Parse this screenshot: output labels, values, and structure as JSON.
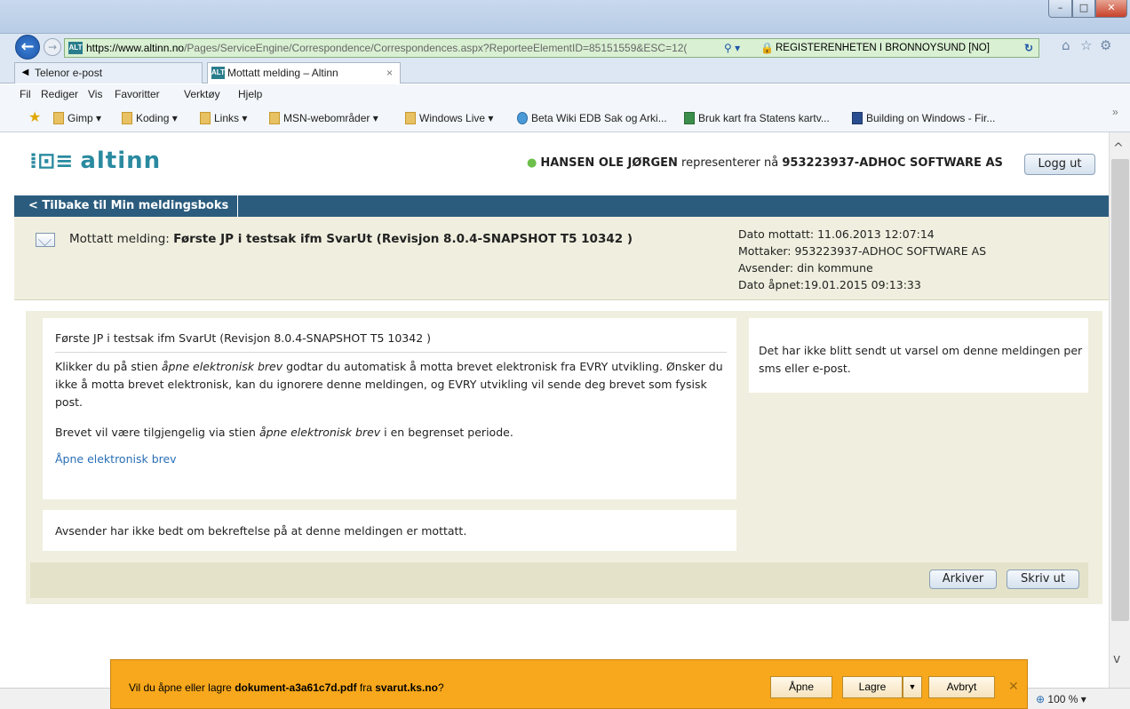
{
  "window": {
    "min": "–",
    "max": "□",
    "close": "✕"
  },
  "browser": {
    "url_host": "https://www.altinn.no",
    "url_rest": "/Pages/ServiceEngine/Correspondence/Correspondences.aspx?ReporteeElementID=85151559&ESC=12(",
    "search_dropdown": "⚲ ▾",
    "certificate": "REGISTERENHETEN I BRONNOYSUND [NO]",
    "tabs": [
      {
        "label": "Telenor e-post"
      },
      {
        "label": "Mottatt melding – Altinn"
      }
    ],
    "menu": [
      "Fil",
      "Rediger",
      "Vis",
      "Favoritter",
      "Verktøy",
      "Hjelp"
    ],
    "favorites": [
      "Gimp ▾",
      "Koding ▾",
      "Links ▾",
      "MSN-webområder ▾",
      "Windows Live ▾",
      "Beta Wiki EDB Sak og Arki...",
      "Bruk kart fra Statens kartv...",
      "Building on Windows - Fir..."
    ],
    "zoom": "100 %"
  },
  "header": {
    "logo_text": "altinn",
    "user_name": "HANSEN OLE JØRGEN",
    "represents_text": "representerer nå",
    "org": "953223937-ADHOC SOFTWARE AS",
    "logout": "Logg ut"
  },
  "nav": {
    "back_link": "< Tilbake til Min meldingsboks"
  },
  "message": {
    "subject_prefix": "Mottatt melding:",
    "subject": "Første JP i testsak ifm SvarUt (Revisjon 8.0.4-SNAPSHOT T5 10342 )",
    "meta": [
      "Dato mottatt: 11.06.2013 12:07:14",
      "Mottaker: 953223937-ADHOC SOFTWARE AS",
      "Avsender: din kommune",
      "Dato åpnet:19.01.2015 09:13:33"
    ],
    "card_title": "Første JP i testsak ifm SvarUt (Revisjon 8.0.4-SNAPSHOT T5 10342 )",
    "para1_a": "Klikker du på stien ",
    "para1_em": "åpne elektronisk brev",
    "para1_b": " godtar du automatisk å motta brevet elektronisk fra EVRY utvikling. Ønsker du ikke å motta brevet elektronisk, kan du ignorere denne meldingen, og EVRY utvikling vil sende deg brevet som fysisk post.",
    "para2_a": "Brevet vil være tilgjengelig via stien ",
    "para2_em": "åpne elektronisk brev",
    "para2_b": " i en begrenset periode.",
    "open_link": "Åpne elektronisk brev",
    "notice": "Det har ikke blitt sendt ut varsel om denne meldingen per sms eller e-post.",
    "confirm": "Avsender har ikke bedt om bekreftelse på at denne meldingen er mottatt.",
    "archive": "Arkiver",
    "print": "Skriv ut"
  },
  "download": {
    "prefix": "Vil du åpne eller lagre ",
    "file": "dokument-a3a61c7d.pdf",
    "middle": " fra ",
    "source": "svarut.ks.no",
    "suffix": "?",
    "open": "Åpne",
    "save": "Lagre",
    "cancel": "Avbryt"
  }
}
